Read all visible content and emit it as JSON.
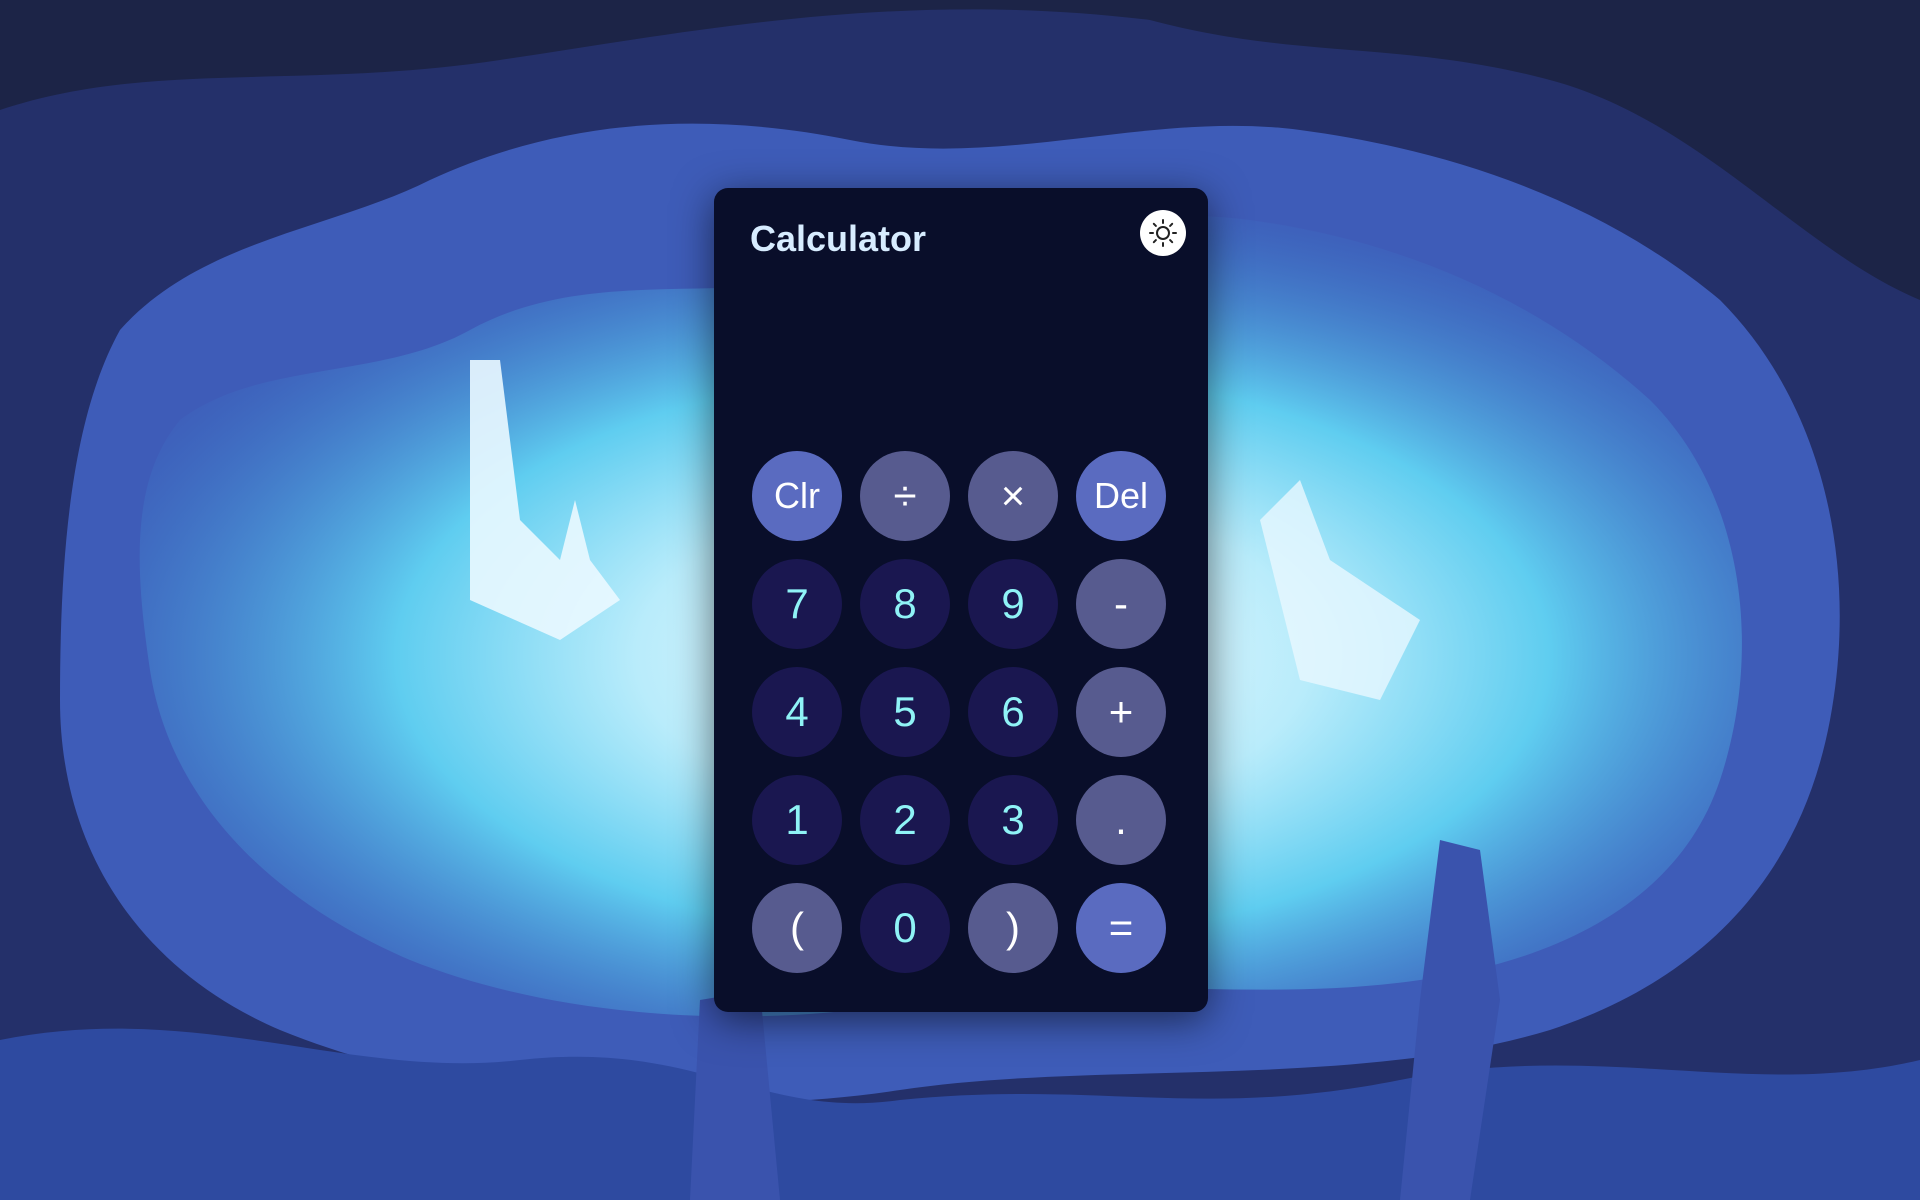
{
  "app": {
    "title": "Calculator",
    "theme_toggle_icon": "sun-icon"
  },
  "display": {
    "value": ""
  },
  "keypad": {
    "rows": [
      [
        {
          "label": "Clr",
          "name": "clear-button",
          "kind": "acc"
        },
        {
          "label": "÷",
          "name": "divide-button",
          "kind": "op"
        },
        {
          "label": "×",
          "name": "multiply-button",
          "kind": "op"
        },
        {
          "label": "Del",
          "name": "delete-button",
          "kind": "acc"
        }
      ],
      [
        {
          "label": "7",
          "name": "digit-7-button",
          "kind": "num"
        },
        {
          "label": "8",
          "name": "digit-8-button",
          "kind": "num"
        },
        {
          "label": "9",
          "name": "digit-9-button",
          "kind": "num"
        },
        {
          "label": "-",
          "name": "subtract-button",
          "kind": "op"
        }
      ],
      [
        {
          "label": "4",
          "name": "digit-4-button",
          "kind": "num"
        },
        {
          "label": "5",
          "name": "digit-5-button",
          "kind": "num"
        },
        {
          "label": "6",
          "name": "digit-6-button",
          "kind": "num"
        },
        {
          "label": "+",
          "name": "add-button",
          "kind": "op"
        }
      ],
      [
        {
          "label": "1",
          "name": "digit-1-button",
          "kind": "num"
        },
        {
          "label": "2",
          "name": "digit-2-button",
          "kind": "num"
        },
        {
          "label": "3",
          "name": "digit-3-button",
          "kind": "num"
        },
        {
          "label": ".",
          "name": "decimal-button",
          "kind": "op"
        }
      ],
      [
        {
          "label": "(",
          "name": "open-paren-button",
          "kind": "op"
        },
        {
          "label": "0",
          "name": "digit-0-button",
          "kind": "num"
        },
        {
          "label": ")",
          "name": "close-paren-button",
          "kind": "op"
        },
        {
          "label": "=",
          "name": "equals-button",
          "kind": "acc"
        }
      ]
    ]
  },
  "colors": {
    "panel_bg": "#090e2a",
    "title_text": "#d7ecff",
    "digit_key_bg": "#1a1750",
    "digit_key_text": "#8ff3f6",
    "operator_key_bg": "#575b8f",
    "accent_key_bg": "#5a6bc0"
  }
}
